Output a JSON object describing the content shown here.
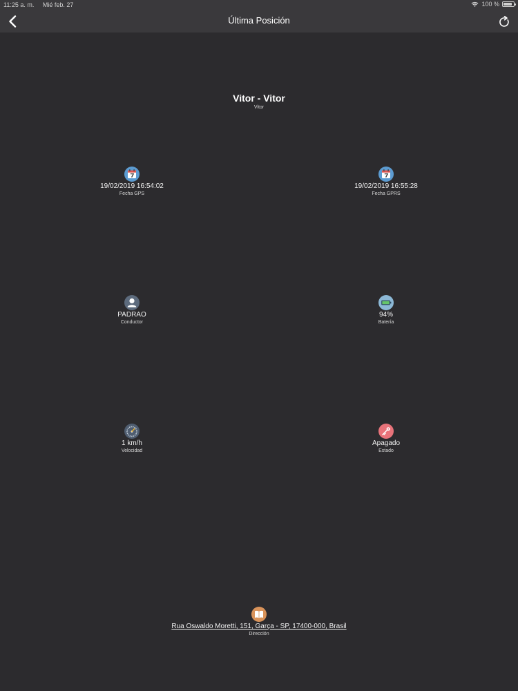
{
  "status_bar": {
    "time": "11:25 a. m.",
    "date": "Mié feb. 27",
    "battery": "100 %"
  },
  "nav": {
    "title": "Última Posición"
  },
  "vehicle": {
    "title": "Vitor - Vitor",
    "subtitle": "Vitor"
  },
  "fields": {
    "gps_date": {
      "value": "19/02/2019 16:54:02",
      "label": "Fecha GPS"
    },
    "gprs_date": {
      "value": "19/02/2019 16:55:28",
      "label": "Fecha GPRS"
    },
    "driver": {
      "value": "PADRAO",
      "label": "Conductor"
    },
    "battery": {
      "value": "94%",
      "label": "Batería"
    },
    "speed": {
      "value": "1 km/h",
      "label": "Velocidad"
    },
    "state": {
      "value": "Apagado",
      "label": "Estado"
    },
    "address": {
      "value": "Rua Oswaldo Moretti, 151, Garça - SP, 17400-000, Brasil",
      "label": "Dirección"
    }
  },
  "icons": {
    "calendar": "calendar-icon",
    "driver": "user-icon",
    "battery": "battery-icon",
    "speed": "speedometer-icon",
    "state": "key-icon",
    "address": "map-book-icon"
  },
  "colors": {
    "background": "#2c2b2e",
    "bar": "#3a393c",
    "calendar_blue": "#5c9bd1",
    "user_slate": "#5d6b7d",
    "battery_blue": "#8cb8d6",
    "speed_slate": "#4f5d70",
    "key_red": "#e8737a",
    "address_orange": "#d9935a"
  }
}
